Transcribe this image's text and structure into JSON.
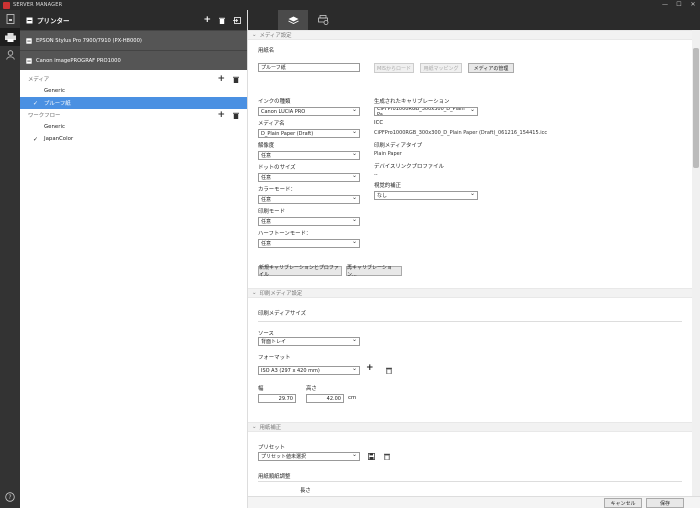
{
  "window": {
    "title": "SERVER MANAGER"
  },
  "sidebar": {
    "title": "プリンター",
    "printers": [
      {
        "name": "EPSON Stylus Pro 7900/7910 (PX-H8000)"
      },
      {
        "name": "Canon imagePROGRAF PRO1000"
      }
    ],
    "media_section": "メディア",
    "media_items": [
      {
        "label": "Generic",
        "checked": false
      },
      {
        "label": "プルーフ紙",
        "checked": true
      }
    ],
    "workflow_section": "ワークフロー",
    "workflow_items": [
      {
        "label": "Generic",
        "checked": false
      },
      {
        "label": "JapanColor",
        "checked": true
      }
    ]
  },
  "media_settings": {
    "header": "メディア設定",
    "paper_name_label": "用紙名",
    "paper_name_value": "プルーフ紙",
    "btn_mis_load": "MISからロード",
    "btn_paper_mapping": "用紙マッピング",
    "btn_manage_media": "メディアの管理",
    "ink_type_label": "インクの種類",
    "ink_type_value": "Canon LUCIA PRO",
    "media_name_label": "メディア名",
    "media_name_value": "D_Plain Paper (Draft)",
    "resolution_label": "解像度",
    "resolution_value": "任意",
    "dot_size_label": "ドットのサイズ",
    "dot_size_value": "任意",
    "color_mode_label": "カラーモード：",
    "color_mode_value": "任意",
    "print_mode_label": "印刷モード",
    "print_mode_value": "任意",
    "halftone_label": "ハーフトーンモード：",
    "halftone_value": "任意",
    "gen_calib_label": "生成されたキャリブレーション",
    "gen_calib_value": "CiPFPro1000RGB_300x300_D_Plain Pa…",
    "icc_label": "ICC",
    "icc_value": "CiPFPro1000RGB_300x300_D_Plain Paper (Draft)_061216_154415.icc",
    "print_media_type_label": "印刷メディアタイプ",
    "print_media_type_value": "Plain Paper",
    "device_link_label": "デバイスリンクプロファイル",
    "device_link_value": "--",
    "visual_corr_label": "視覚的補正",
    "visual_corr_value": "なし",
    "btn_new_calib": "新規キャリブレーションとプロファイル",
    "btn_recalib": "再キャリブレーション..."
  },
  "print_media": {
    "header": "印刷メディア設定",
    "size_label": "印刷メディアサイズ",
    "source_label": "ソース",
    "source_value": "背面トレイ",
    "format_label": "フォーマット",
    "format_value": "ISO A3 (297 x 420 mm)",
    "width_label": "幅",
    "width_value": "29.70",
    "height_label": "高さ",
    "height_value": "42.00",
    "unit": "cm"
  },
  "paper_correction": {
    "header": "用紙補正",
    "preset_label": "プリセット",
    "preset_value": "プリセット値未選択",
    "feed_adjust_label": "用紙順紙調整",
    "length_label": "長さ"
  },
  "footer": {
    "cancel": "キャンセル",
    "save": "保存"
  }
}
